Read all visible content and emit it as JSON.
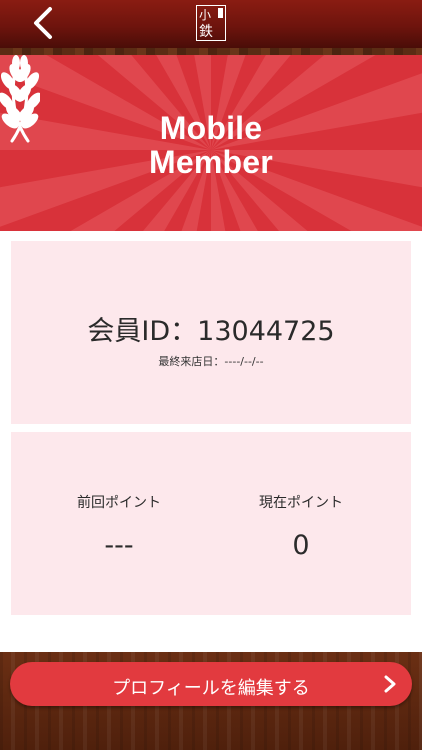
{
  "header": {
    "logo_label": "小鉄",
    "back_icon": "chevron-left-icon"
  },
  "banner": {
    "title_line1": "Mobile",
    "title_line2": "Member",
    "left_icon": "laurel-icon",
    "right_icon": "laurel-icon",
    "colors": {
      "ray_dark": "#d8323a",
      "ray_light": "#e85a5e"
    }
  },
  "member": {
    "id_text": "会員ID：13044725",
    "last_visit_text": "最終来店日：----/--/--"
  },
  "points": {
    "previous_label": "前回ポイント",
    "previous_value": "---",
    "current_label": "現在ポイント",
    "current_value": "0"
  },
  "footer": {
    "edit_profile_label": "プロフィールを編集する",
    "chevron_icon": "chevron-right-icon",
    "button_color": "#e23a3f"
  }
}
